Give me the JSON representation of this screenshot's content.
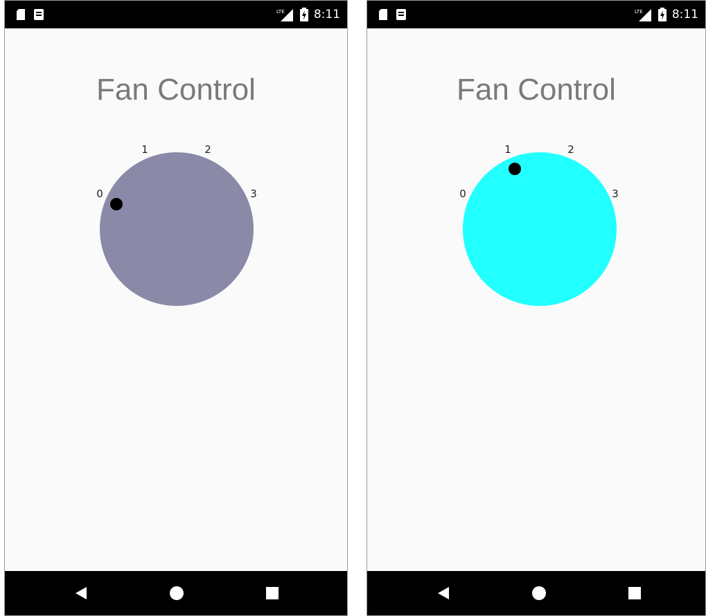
{
  "screens": [
    {
      "status_time": "8:11",
      "title": "Fan Control",
      "dial": {
        "tick_labels": [
          "0",
          "1",
          "2",
          "3"
        ],
        "selected_level": 0,
        "color": "#8a8aa8"
      },
      "icons": [
        "sd-card-icon",
        "notification-icon",
        "lte-signal-icon",
        "battery-charging-icon"
      ]
    },
    {
      "status_time": "8:11",
      "title": "Fan Control",
      "dial": {
        "tick_labels": [
          "0",
          "1",
          "2",
          "3"
        ],
        "selected_level": 1,
        "color": "#22ffff"
      },
      "icons": [
        "sd-card-icon",
        "notification-icon",
        "lte-signal-icon",
        "battery-charging-icon"
      ]
    }
  ],
  "nav": {
    "back": "back-icon",
    "home": "home-icon",
    "recents": "recents-icon"
  }
}
